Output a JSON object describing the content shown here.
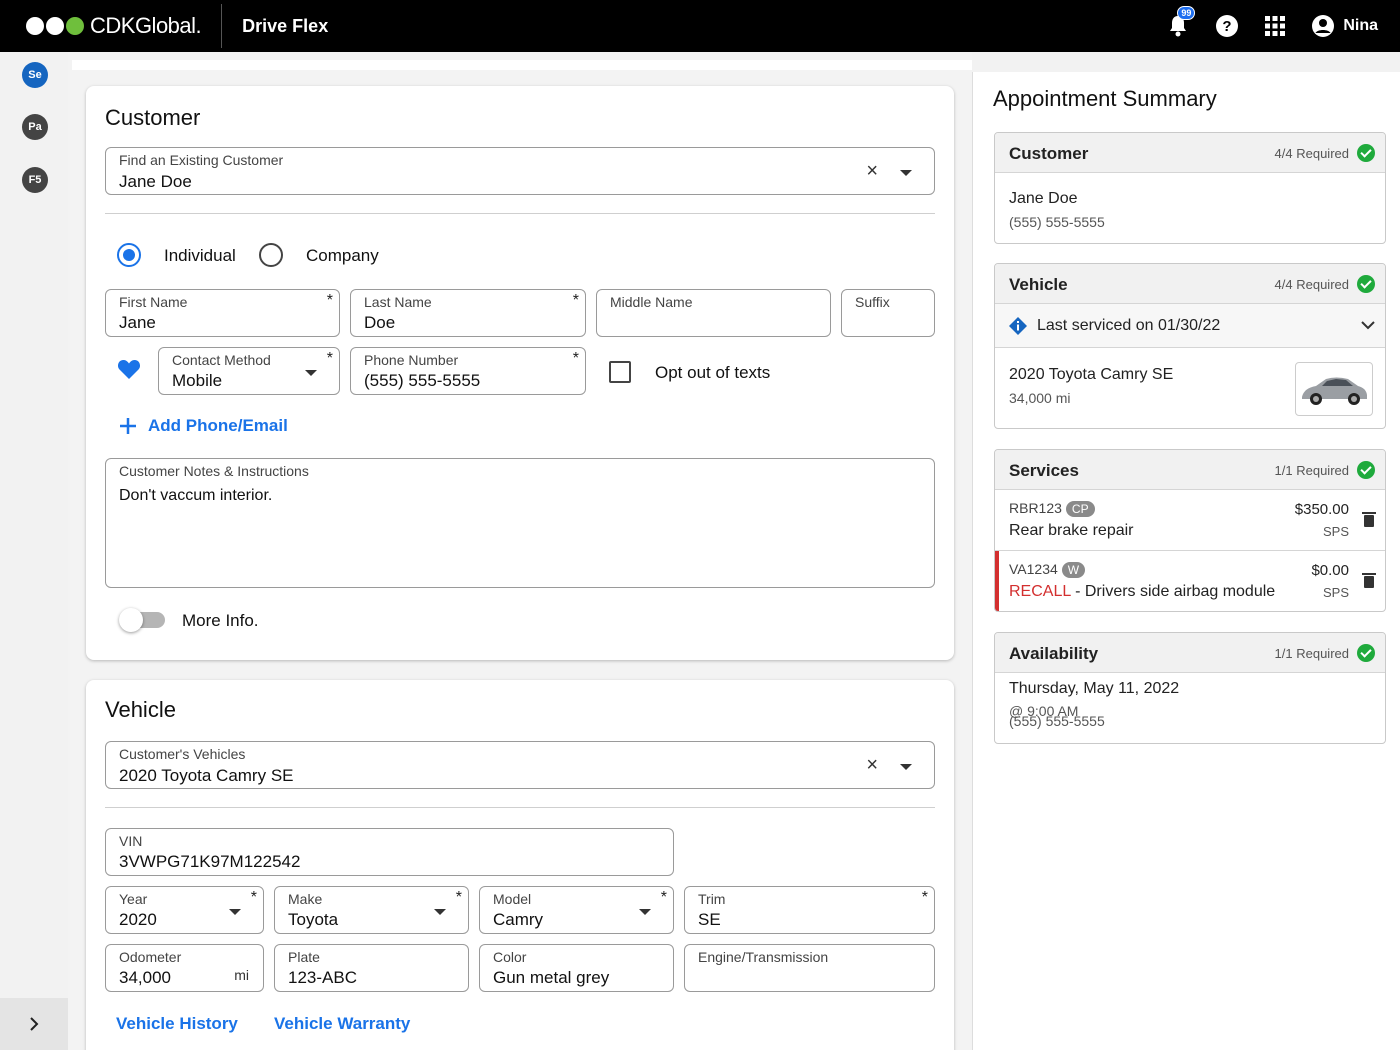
{
  "header": {
    "brand": "CDKGlobal.",
    "app_name": "Drive Flex",
    "notification_count": "99",
    "user_name": "Nina"
  },
  "rail": {
    "chips": [
      "Se",
      "Pa",
      "F5"
    ],
    "expand_icon": "chevron-right-icon"
  },
  "customer": {
    "title": "Customer",
    "find_label": "Find an Existing Customer",
    "find_value": "Jane Doe",
    "type_individual": "Individual",
    "type_company": "Company",
    "first_name_label": "First Name",
    "first_name": "Jane",
    "last_name_label": "Last Name",
    "last_name": "Doe",
    "middle_name_label": "Middle Name",
    "suffix_label": "Suffix",
    "contact_method_label": "Contact Method",
    "contact_method": "Mobile",
    "phone_label": "Phone Number",
    "phone": "(555) 555-5555",
    "opt_out_label": "Opt out of texts",
    "add_phone_label": "Add Phone/Email",
    "notes_label": "Customer Notes & Instructions",
    "notes": "Don't vaccum interior.",
    "more_info_label": "More Info."
  },
  "vehicle": {
    "title": "Vehicle",
    "select_label": "Customer's Vehicles",
    "select_value": "2020 Toyota Camry SE",
    "vin_label": "VIN",
    "vin": "3VWPG71K97M122542",
    "year_label": "Year",
    "year": "2020",
    "make_label": "Make",
    "make": "Toyota",
    "model_label": "Model",
    "model": "Camry",
    "trim_label": "Trim",
    "trim": "SE",
    "odometer_label": "Odometer",
    "odometer": "34,000",
    "odometer_unit": "mi",
    "plate_label": "Plate",
    "plate": "123-ABC",
    "color_label": "Color",
    "color": "Gun metal grey",
    "engine_label": "Engine/Transmission",
    "history_link": "Vehicle History",
    "warranty_link": "Vehicle Warranty"
  },
  "summary": {
    "title": "Appointment Summary",
    "customer": {
      "title": "Customer",
      "required": "4/4 Required",
      "name": "Jane Doe",
      "phone": "(555) 555-5555"
    },
    "vehicle": {
      "title": "Vehicle",
      "required": "4/4 Required",
      "last_serviced": "Last serviced on 01/30/22",
      "name": "2020 Toyota Camry SE",
      "mileage": "34,000 mi"
    },
    "services": {
      "title": "Services",
      "required": "1/1 Required",
      "items": [
        {
          "code": "RBR123",
          "tag": "CP",
          "name": "Rear brake repair",
          "recall": "",
          "price": "$350.00",
          "pay": "SPS"
        },
        {
          "code": "VA1234",
          "tag": "W",
          "recall": "RECALL",
          "name": " - Drivers side airbag module",
          "price": "$0.00",
          "pay": "SPS"
        }
      ]
    },
    "availability": {
      "title": "Availability",
      "required": "1/1 Required",
      "date": "Thursday, May 11, 2022",
      "time": "@ 9:00 AM",
      "phone": "(555) 555-5555"
    }
  },
  "colors": {
    "accent": "#1a73e8",
    "success": "#1faa3c",
    "recall": "#d32f2f",
    "header_bg": "#000000"
  }
}
